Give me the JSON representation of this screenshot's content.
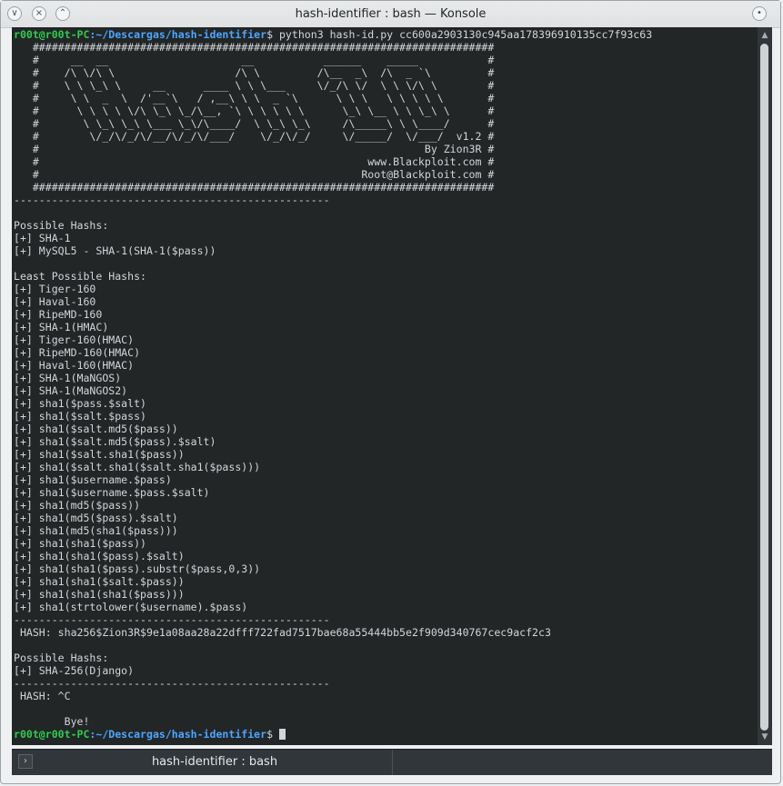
{
  "window": {
    "title": "hash-identifier : bash — Konsole",
    "buttons": {
      "menu": "∨",
      "minimize": "⌃",
      "close": "×",
      "keep_above": "•"
    }
  },
  "terminal": {
    "prompt": {
      "user": "r00t@r00t-PC",
      "path": ":~/Descargas/hash-identifier",
      "symbol": "$"
    },
    "command": " python3 hash-id.py cc600a2903130c945aa178396910135cc7f93c63",
    "banner": [
      "   #########################################################################",
      "   #     __  __                     __           ______    _____           #",
      "   #    /\\ \\/\\ \\                   /\\ \\         /\\__  _\\  /\\  _ `\\         #",
      "   #    \\ \\ \\_\\ \\     __      ____ \\ \\ \\___     \\/_/\\ \\/  \\ \\ \\/\\ \\        #",
      "   #     \\ \\  _  \\  /'__`\\   / ,__\\ \\ \\  _ `\\      \\ \\ \\   \\ \\ \\ \\ \\       #",
      "   #      \\ \\ \\ \\ \\/\\ \\_\\ \\_/\\__, `\\ \\ \\ \\ \\ \\      \\_\\ \\__ \\ \\ \\_\\ \\      #",
      "   #       \\ \\_\\ \\_\\ \\___ \\_\\/\\____/  \\ \\_\\ \\_\\     /\\_____\\ \\ \\____/      #",
      "   #        \\/_/\\/_/\\/__/\\/_/\\/___/    \\/_/\\/_/     \\/_____/  \\/___/  v1.2 #",
      "   #                                                             By Zion3R #",
      "   #                                                    www.Blackploit.com #",
      "   #                                                   Root@Blackploit.com #",
      "   #########################################################################"
    ],
    "output": [
      "--------------------------------------------------",
      "",
      "Possible Hashs:",
      "[+] SHA-1",
      "[+] MySQL5 - SHA-1(SHA-1($pass))",
      "",
      "Least Possible Hashs:",
      "[+] Tiger-160",
      "[+] Haval-160",
      "[+] RipeMD-160",
      "[+] SHA-1(HMAC)",
      "[+] Tiger-160(HMAC)",
      "[+] RipeMD-160(HMAC)",
      "[+] Haval-160(HMAC)",
      "[+] SHA-1(MaNGOS)",
      "[+] SHA-1(MaNGOS2)",
      "[+] sha1($pass.$salt)",
      "[+] sha1($salt.$pass)",
      "[+] sha1($salt.md5($pass))",
      "[+] sha1($salt.md5($pass).$salt)",
      "[+] sha1($salt.sha1($pass))",
      "[+] sha1($salt.sha1($salt.sha1($pass)))",
      "[+] sha1($username.$pass)",
      "[+] sha1($username.$pass.$salt)",
      "[+] sha1(md5($pass))",
      "[+] sha1(md5($pass).$salt)",
      "[+] sha1(md5(sha1($pass)))",
      "[+] sha1(sha1($pass))",
      "[+] sha1(sha1($pass).$salt)",
      "[+] sha1(sha1($pass).substr($pass,0,3))",
      "[+] sha1(sha1($salt.$pass))",
      "[+] sha1(sha1(sha1($pass)))",
      "[+] sha1(strtolower($username).$pass)",
      "--------------------------------------------------",
      " HASH: sha256$Zion3R$9e1a08aa28a22dfff722fad7517bae68a55444bb5e2f909d340767cec9acf2c3",
      "",
      "Possible Hashs:",
      "[+] SHA-256(Django)",
      "--------------------------------------------------",
      " HASH: ^C",
      "",
      "        Bye!"
    ]
  },
  "tabs": [
    {
      "label": "hash-identifier : bash"
    }
  ],
  "colors": {
    "background": "#232627",
    "text": "#d2d6da",
    "prompt_user": "#2ecc4e",
    "prompt_path": "#4da6ff"
  }
}
